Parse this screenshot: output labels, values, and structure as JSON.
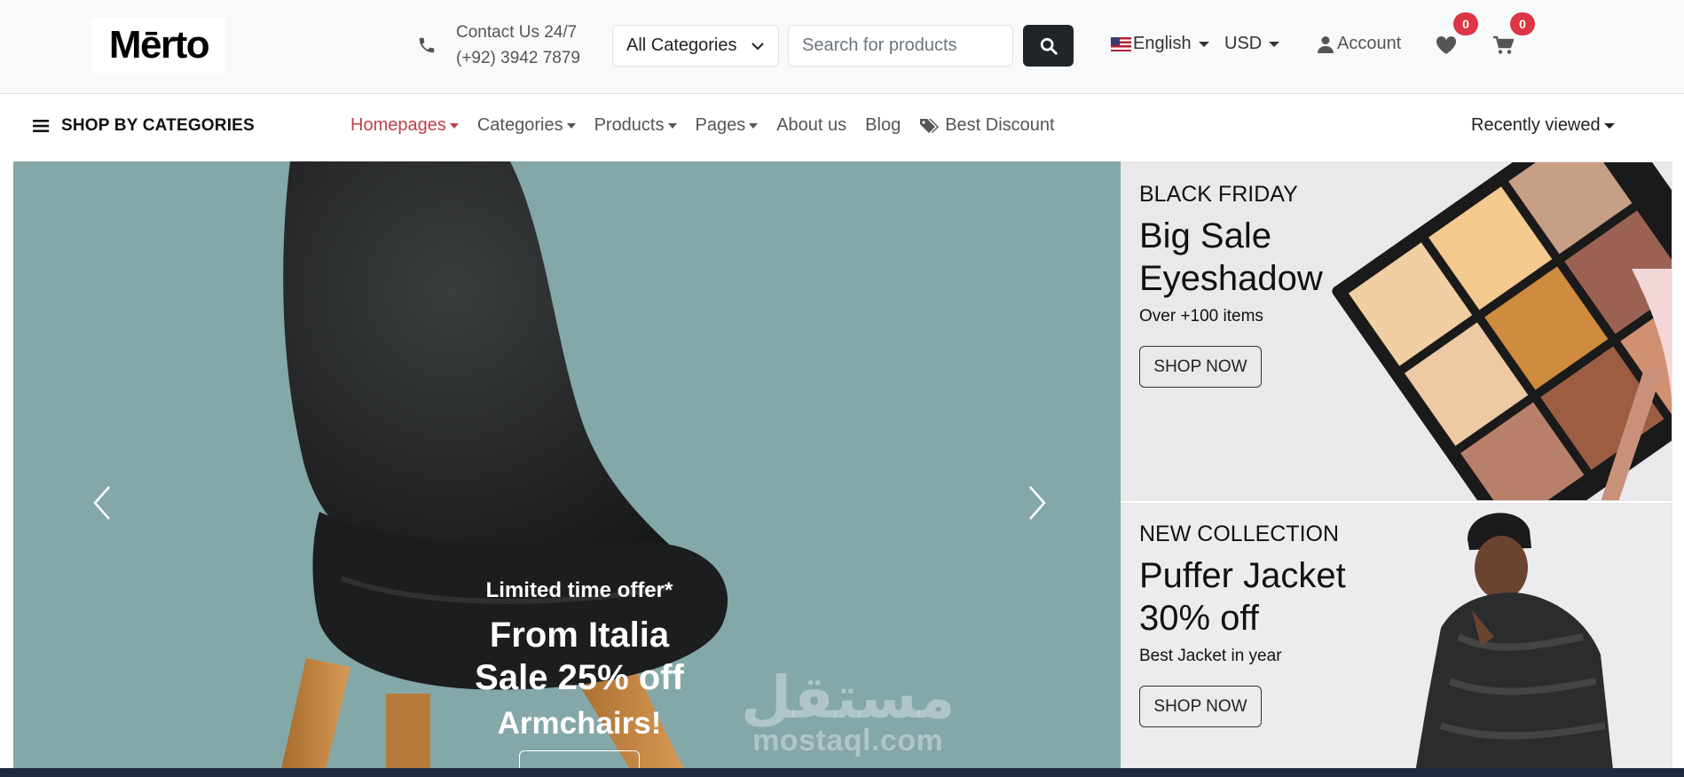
{
  "header": {
    "logo_text": "Mērto",
    "contact": {
      "line1": "Contact Us 24/7",
      "line2": "(+92) 3942 7879"
    },
    "category_select": "All Categories",
    "search_placeholder": "Search for products",
    "language": "English",
    "currency": "USD",
    "account": "Account",
    "wishlist_count": "0",
    "cart_count": "0"
  },
  "nav": {
    "shop_by_categories": "SHOP BY CATEGORIES",
    "items": [
      {
        "label": "Homepages",
        "dropdown": true,
        "active": true
      },
      {
        "label": "Categories",
        "dropdown": true
      },
      {
        "label": "Products",
        "dropdown": true
      },
      {
        "label": "Pages",
        "dropdown": true
      },
      {
        "label": "About us"
      },
      {
        "label": "Blog"
      },
      {
        "label": "Best Discount",
        "icon": "tags-icon"
      }
    ],
    "recently_viewed": "Recently viewed"
  },
  "hero": {
    "offer": "Limited time offer*",
    "line1": "From Italia",
    "line2": "Sale 25% off",
    "line3": "Armchairs!",
    "bg_color": "#84a7a8",
    "watermark_ar": "مستقل",
    "watermark_en": "mostaql.com"
  },
  "banners": [
    {
      "tag": "BLACK FRIDAY",
      "title_line1": "Big Sale",
      "title_line2": "Eyeshadow",
      "subtitle": "Over +100 items",
      "button": "SHOP NOW"
    },
    {
      "tag": "NEW COLLECTION",
      "title_line1": "Puffer Jacket",
      "title_line2": "30% off",
      "subtitle": "Best Jacket in year",
      "button": "SHOP NOW"
    }
  ],
  "colors": {
    "accent": "#dc3545",
    "dark": "#212529",
    "nav_active": "#c0404a"
  }
}
